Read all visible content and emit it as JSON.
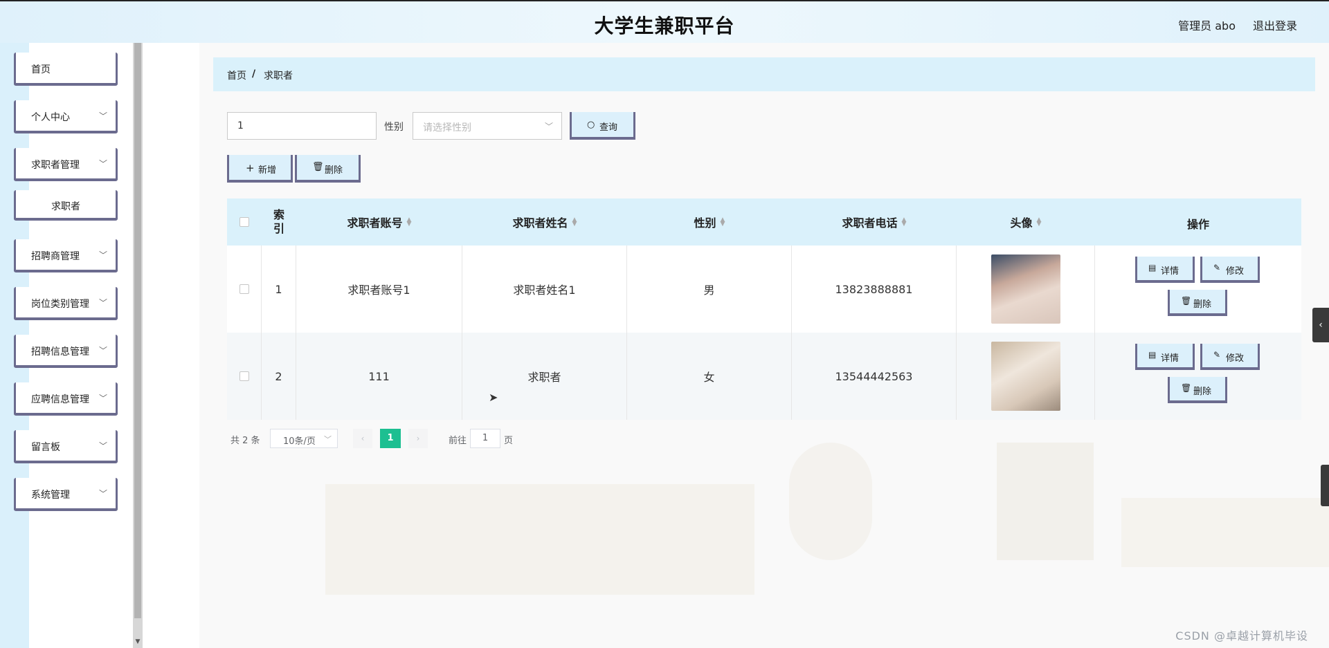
{
  "header": {
    "title": "大学生兼职平台",
    "admin": "管理员 abo",
    "logout": "退出登录"
  },
  "sidebar": {
    "items": [
      {
        "label": "首页",
        "chevron": false
      },
      {
        "label": "个人中心",
        "chevron": true
      },
      {
        "label": "求职者管理",
        "chevron": true
      },
      {
        "label": "求职者",
        "sub": true
      },
      {
        "label": "招聘商管理",
        "chevron": true
      },
      {
        "label": "岗位类别管理",
        "chevron": true
      },
      {
        "label": "招聘信息管理",
        "chevron": true
      },
      {
        "label": "应聘信息管理",
        "chevron": true
      },
      {
        "label": "留言板",
        "chevron": true
      },
      {
        "label": "系统管理",
        "chevron": true
      }
    ]
  },
  "breadcrumb": {
    "home": "首页",
    "sep": "/",
    "current": "求职者"
  },
  "search": {
    "keyword_value": "1",
    "gender_label": "性别",
    "gender_placeholder": "请选择性别",
    "query_label": "查询"
  },
  "actions": {
    "add_label": "新增",
    "delete_label": "删除"
  },
  "table": {
    "columns": [
      "索引",
      "求职者账号",
      "求职者姓名",
      "性别",
      "求职者电话",
      "头像",
      "操作"
    ],
    "rows": [
      {
        "index": "1",
        "account": "求职者账号1",
        "name": "求职者姓名1",
        "gender": "男",
        "phone": "13823888881"
      },
      {
        "index": "2",
        "account": "111",
        "name": "求职者",
        "gender": "女",
        "phone": "13544442563"
      }
    ],
    "op_detail": "详情",
    "op_edit": "修改",
    "op_delete": "删除"
  },
  "pagination": {
    "total": "共 2 条",
    "page_size": "10条/页",
    "current_page": "1",
    "goto_label": "前往",
    "goto_value": "1",
    "unit": "页"
  },
  "watermark": "CSDN @卓越计算机毕设"
}
